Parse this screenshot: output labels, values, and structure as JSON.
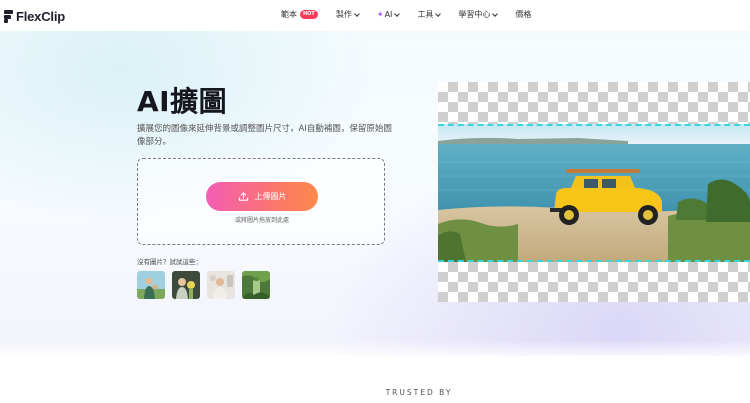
{
  "logo": {
    "text": "FlexClip"
  },
  "nav": {
    "items": [
      {
        "label": "範本",
        "badge": "HOT"
      },
      {
        "label": "製作",
        "dropdown": true
      },
      {
        "label": "AI",
        "dropdown": true,
        "sparkle": "✦"
      },
      {
        "label": "工具",
        "dropdown": true
      },
      {
        "label": "學習中心",
        "dropdown": true
      },
      {
        "label": "價格"
      }
    ]
  },
  "hero": {
    "title": "AI擴圖",
    "subtitle": "擴展您的圖像來延伸背景或調整圖片尺寸，AI自動補圖，保留原始圖像部分。",
    "upload_button": "上傳圖片",
    "drag_hint": "或將圖片拖放到此處",
    "try_label": "沒有圖片？試試這些：",
    "samples": [
      "sample-1",
      "sample-2",
      "sample-3",
      "sample-4"
    ]
  },
  "colors": {
    "accent_start": "#f35db4",
    "accent_end": "#fd8a4c",
    "hot_badge": "#ff3b5c",
    "crop_guide": "#36d6e0"
  },
  "footer": {
    "trusted_by": "TRUSTED BY"
  }
}
